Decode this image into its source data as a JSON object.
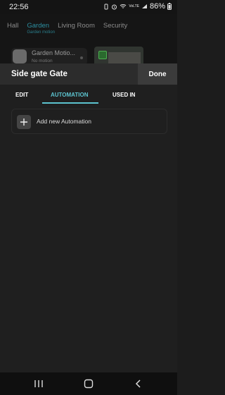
{
  "status_bar": {
    "time": "22:56",
    "battery": "86%",
    "icons": [
      "vibrate-icon",
      "alarm-icon",
      "wifi-icon",
      "signal-icon",
      "battery-icon"
    ],
    "network": "VoLTE"
  },
  "background": {
    "room_tabs": [
      {
        "label": "Hall"
      },
      {
        "label": "Garden",
        "sub": "Garden motion"
      },
      {
        "label": "Living Room"
      },
      {
        "label": "Security"
      }
    ],
    "device": {
      "name": "Garden Motio...",
      "status": "No motion"
    }
  },
  "sheet": {
    "title": "Side gate Gate",
    "done_label": "Done",
    "tabs": [
      {
        "label": "EDIT"
      },
      {
        "label": "AUTOMATION",
        "active": true
      },
      {
        "label": "USED IN"
      }
    ],
    "add_automation_label": "Add new Automation"
  },
  "colors": {
    "accent": "#5cc3cf",
    "header_bg": "#2c2c2c",
    "sheet_bg": "#1f1f1f"
  }
}
